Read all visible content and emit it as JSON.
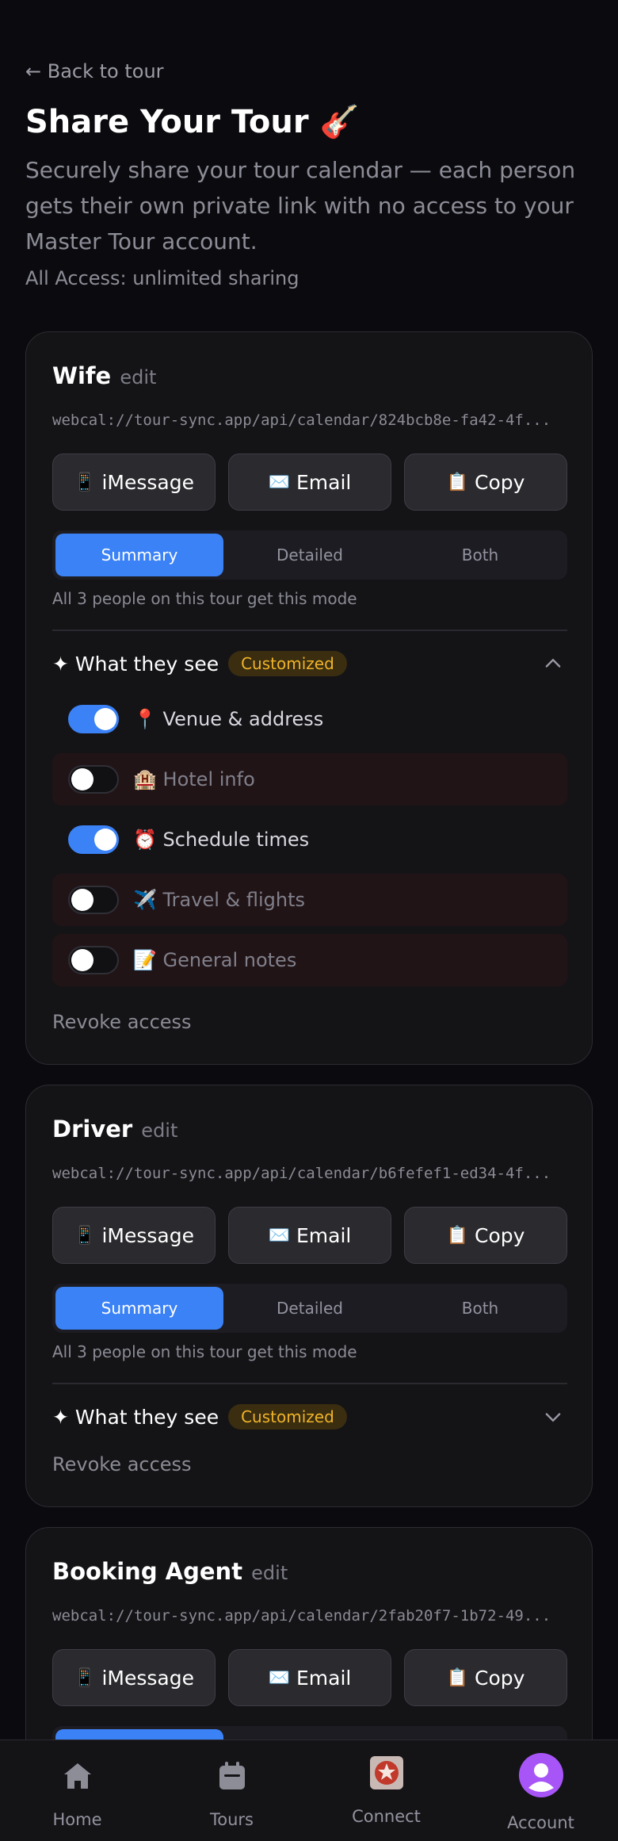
{
  "header": {
    "back_label": "← Back to tour",
    "title": "Share Your Tour 🎸",
    "subtitle": "Securely share your tour calendar — each person gets their own private link with no access to your Master Tour account.",
    "access_note": "All Access: unlimited sharing"
  },
  "cards": [
    {
      "name": "Wife",
      "edit_label": "edit",
      "url": "webcal://tour-sync.app/api/calendar/824bcb8e-fa42-4f...",
      "actions": [
        {
          "icon": "📱",
          "label": "iMessage"
        },
        {
          "icon": "✉️",
          "label": "Email"
        },
        {
          "icon": "📋",
          "label": "Copy"
        }
      ],
      "modes": [
        "Summary",
        "Detailed",
        "Both"
      ],
      "active_mode": "Summary",
      "mode_note": "All 3 people on this tour get this mode",
      "see_label": "✦ What they see",
      "badge": "Customized",
      "expanded": true,
      "toggles": [
        {
          "icon": "📍",
          "label": "Venue & address",
          "on": true
        },
        {
          "icon": "🏨",
          "label": "Hotel info",
          "on": false
        },
        {
          "icon": "⏰",
          "label": "Schedule times",
          "on": true
        },
        {
          "icon": "✈️",
          "label": "Travel & flights",
          "on": false
        },
        {
          "icon": "📝",
          "label": "General notes",
          "on": false
        }
      ],
      "revoke_label": "Revoke access"
    },
    {
      "name": "Driver",
      "edit_label": "edit",
      "url": "webcal://tour-sync.app/api/calendar/b6fefef1-ed34-4f...",
      "actions": [
        {
          "icon": "📱",
          "label": "iMessage"
        },
        {
          "icon": "✉️",
          "label": "Email"
        },
        {
          "icon": "📋",
          "label": "Copy"
        }
      ],
      "modes": [
        "Summary",
        "Detailed",
        "Both"
      ],
      "active_mode": "Summary",
      "mode_note": "All 3 people on this tour get this mode",
      "see_label": "✦ What they see",
      "badge": "Customized",
      "expanded": false,
      "revoke_label": "Revoke access"
    },
    {
      "name": "Booking Agent",
      "edit_label": "edit",
      "url": "webcal://tour-sync.app/api/calendar/2fab20f7-1b72-49...",
      "actions": [
        {
          "icon": "📱",
          "label": "iMessage"
        },
        {
          "icon": "✉️",
          "label": "Email"
        },
        {
          "icon": "📋",
          "label": "Copy"
        }
      ]
    }
  ],
  "nav": [
    {
      "label": "Home",
      "icon": "home-icon"
    },
    {
      "label": "Tours",
      "icon": "calendar-icon"
    },
    {
      "label": "Connect",
      "icon": "connect-logo-icon"
    },
    {
      "label": "Account",
      "icon": "avatar-icon"
    }
  ],
  "colors": {
    "accent": "#3b82f6",
    "badge_text": "#f0b429",
    "background": "#0b0b0f",
    "card": "#141417",
    "avatar": "#a855f7"
  }
}
